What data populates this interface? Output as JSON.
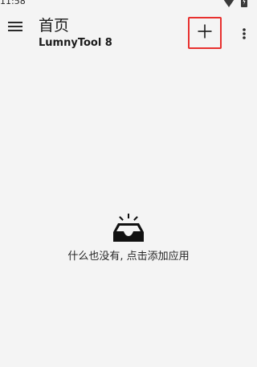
{
  "status_bar": {
    "time": "11:58",
    "icons": [
      "wifi-icon",
      "battery-icon"
    ]
  },
  "app_bar": {
    "title": "首页",
    "subtitle": "LumnyTool 8",
    "menu_icon": "hamburger-menu-icon",
    "add_icon": "plus-icon",
    "more_icon": "more-vertical-icon",
    "highlight_color": "#e8302e"
  },
  "empty_state": {
    "icon": "empty-inbox-icon",
    "message": "什么也没有, 点击添加应用"
  }
}
